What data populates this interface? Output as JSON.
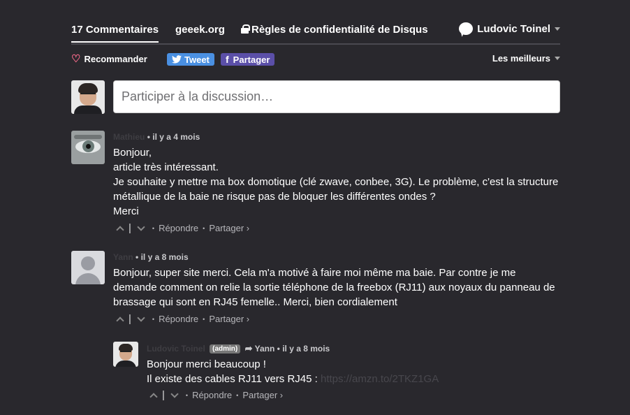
{
  "nav": {
    "comments_tab": "17 Commentaires",
    "site_tab": "geeek.org",
    "privacy_tab": "Règles de confidentialité de Disqus",
    "user_name": "Ludovic Toinel"
  },
  "actions": {
    "recommend": "Recommander",
    "tweet": "Tweet",
    "share": "Partager",
    "sort": "Les meilleurs"
  },
  "composer": {
    "placeholder": "Participer à la discussion…"
  },
  "comments": [
    {
      "author": "Mathieu",
      "time": "il y a 4 mois",
      "lines": [
        "Bonjour,",
        "article très intéressant.",
        "Je souhaite y mettre ma box domotique (clé zwave, conbee, 3G). Le problème, c'est la structure",
        "métallique de la baie ne risque pas de bloquer les différentes ondes ?",
        "Merci"
      ],
      "reply": "Répondre",
      "share": "Partager ›"
    },
    {
      "author": "Yann",
      "time": "il y a 8 mois",
      "lines": [
        "Bonjour, super site merci. Cela m'a motivé à faire moi même ma baie. Par contre je me",
        "demande comment on relie la sortie téléphone de la freebox (RJ11) aux noyaux du panneau de",
        "brassage qui sont en RJ45 femelle.. Merci, bien cordialement"
      ],
      "reply": "Répondre",
      "share": "Partager ›"
    },
    {
      "author": "Ludovic Toinel",
      "badge": "(admin)",
      "reply_to": "Yann",
      "time": "il y a 8 mois",
      "line1": "Bonjour merci beaucoup !",
      "line2": "Il existe des cables RJ11 vers RJ45 : ",
      "link": "https://amzn.to/2TKZ1GA",
      "reply": "Répondre",
      "share": "Partager ›"
    }
  ],
  "separator": "•"
}
